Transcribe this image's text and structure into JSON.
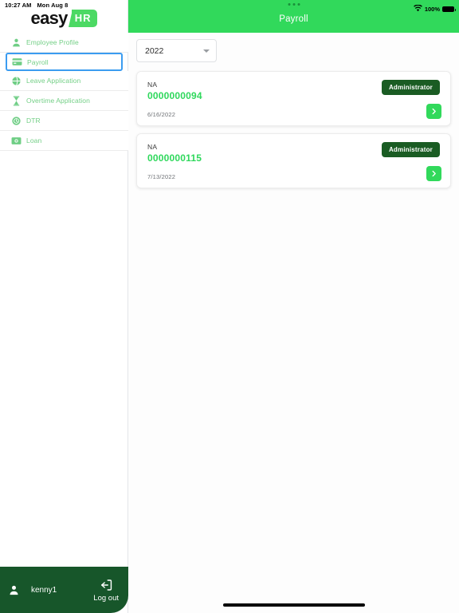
{
  "status_bar": {
    "time": "10:27 AM",
    "date": "Mon Aug 8",
    "battery_percent": "100%",
    "wifi_icon": "wifi-icon",
    "battery_icon": "battery-full-icon",
    "multitask_icon": "three-dots-icon"
  },
  "brand": {
    "name_primary": "easy",
    "name_secondary": "HR",
    "accent_color": "#4cd964"
  },
  "sidebar": {
    "items": [
      {
        "label": "Employee Profile",
        "icon": "person-icon",
        "active": false
      },
      {
        "label": "Payroll",
        "icon": "card-icon",
        "active": true
      },
      {
        "label": "Leave Application",
        "icon": "globe-icon",
        "active": false
      },
      {
        "label": "Overtime Application",
        "icon": "hourglass-icon",
        "active": false
      },
      {
        "label": "DTR",
        "icon": "clock-icon",
        "active": false
      },
      {
        "label": "Loan",
        "icon": "money-icon",
        "active": false
      }
    ],
    "user": {
      "avatar_icon": "person-icon",
      "username": "kenny1",
      "logout_label": "Log out",
      "logout_icon": "logout-icon",
      "bar_color": "#17562a"
    }
  },
  "header": {
    "title": "Payroll",
    "background_color": "#31d95b"
  },
  "filters": {
    "year": {
      "value": "2022",
      "caret_icon": "chevron-down-icon"
    }
  },
  "payroll_list": [
    {
      "name": "NA",
      "number": "0000000094",
      "date": "6/16/2022",
      "role": "Administrator",
      "action_icon": "chevron-right-icon"
    },
    {
      "name": "NA",
      "number": "0000000115",
      "date": "7/13/2022",
      "role": "Administrator",
      "action_icon": "chevron-right-icon"
    }
  ],
  "colors": {
    "green_primary": "#31d95b",
    "green_number": "#2fd85c",
    "green_dark": "#1a5c23",
    "green_sidebar_text": "#73cf86",
    "blue_focus": "#3b9cf0"
  }
}
